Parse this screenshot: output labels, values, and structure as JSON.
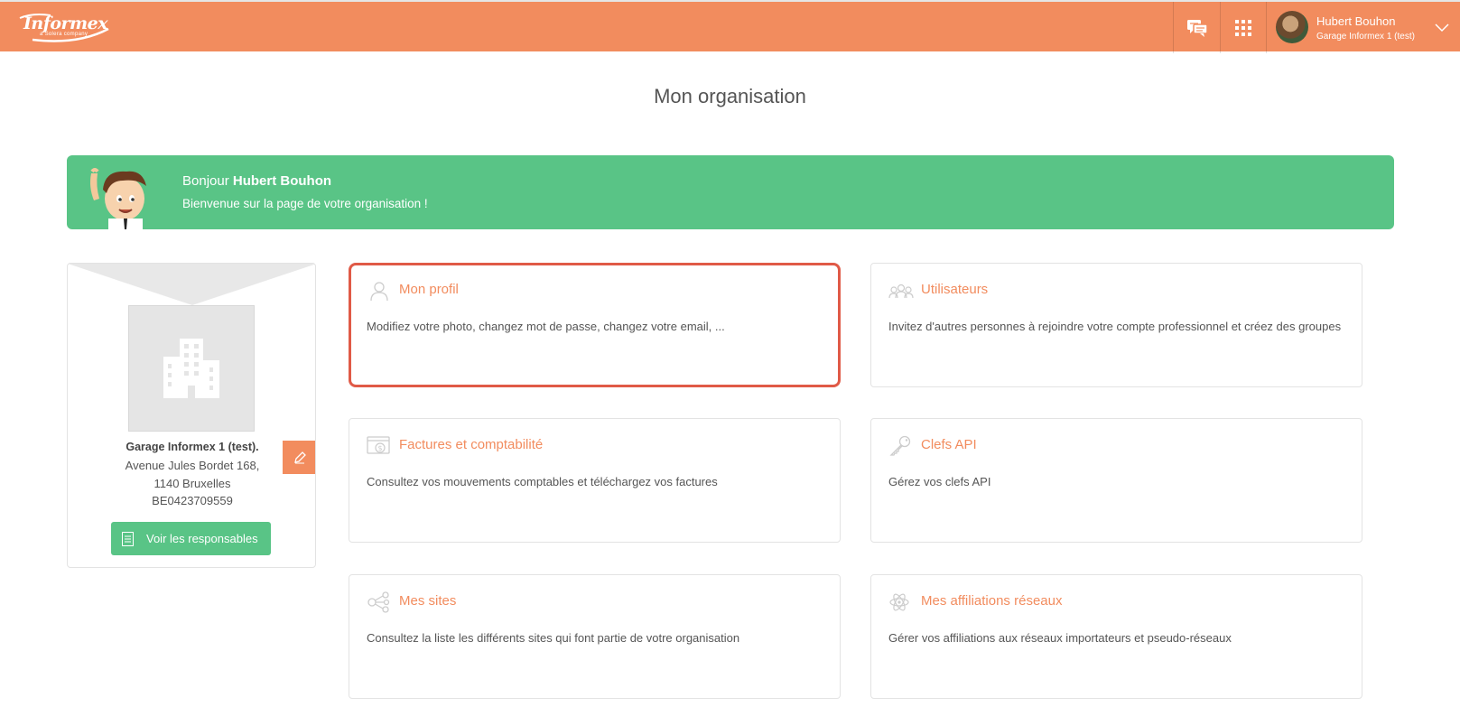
{
  "header": {
    "logo_text": "Informex",
    "logo_sub": "a Solera company",
    "user_name": "Hubert Bouhon",
    "user_org": "Garage Informex 1 (test)"
  },
  "page": {
    "title": "Mon organisation"
  },
  "banner": {
    "greeting": "Bonjour",
    "user": "Hubert Bouhon",
    "welcome": "Bienvenue sur la page de votre organisation !"
  },
  "organization": {
    "name": "Garage Informex 1 (test).",
    "address_line1": "Avenue Jules Bordet 168,",
    "address_line2": "1140 Bruxelles",
    "vat": "BE0423709559",
    "responsables_button": "Voir les responsables"
  },
  "tiles": [
    {
      "title": "Mon profil",
      "description": "Modifiez votre photo, changez mot de passe, changez votre email, ...",
      "icon": "user-icon"
    },
    {
      "title": "Utilisateurs",
      "description": "Invitez d'autres personnes à rejoindre votre compte professionnel et créez des groupes",
      "icon": "users-icon"
    },
    {
      "title": "Factures et comptabilité",
      "description": "Consultez vos mouvements comptables et téléchargez vos factures",
      "icon": "invoice-icon"
    },
    {
      "title": "Clefs API",
      "description": "Gérez vos clefs API",
      "icon": "key-icon"
    },
    {
      "title": "Mes sites",
      "description": "Consultez la liste les différents sites qui font partie de votre organisation",
      "icon": "share-icon"
    },
    {
      "title": "Mes affiliations réseaux",
      "description": "Gérer vos affiliations aux réseaux importateurs et pseudo-réseaux",
      "icon": "atom-icon"
    }
  ],
  "colors": {
    "header": "#f28c5e",
    "banner": "#59c486",
    "accent": "#f28c5e",
    "selected_outline": "#e05a47"
  }
}
